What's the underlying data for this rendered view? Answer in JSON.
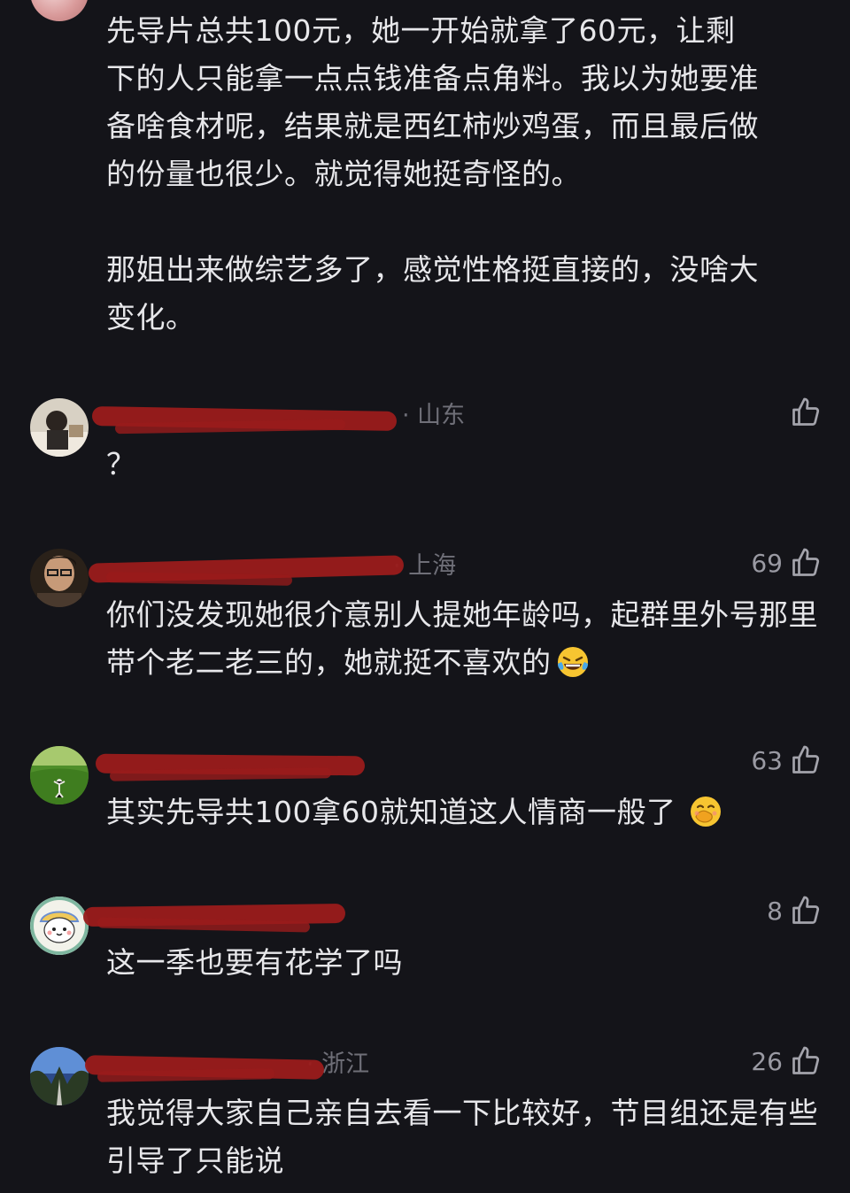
{
  "top_comment": {
    "text": "先导片总共100元，她一开始就拿了60元，让剩\n下的人只能拿一点点钱准备点角料。我以为她要准\n备啥食材呢，结果就是西红柿炒鸡蛋，而且最后做\n的份量也很少。就觉得她挺奇怪的。\n\n那姐出来做综艺多了，感觉性格挺直接的，没啥大\n变化。"
  },
  "comments": [
    {
      "meta_visible": "· 山东",
      "likes": "",
      "text": "？",
      "emoji": ""
    },
    {
      "meta_visible": "· 上海",
      "likes": "69",
      "text": "你们没发现她很介意别人提她年龄吗，起群里外号那里带个老二老三的，她就挺不喜欢的",
      "emoji": "laughing-tears"
    },
    {
      "meta_visible": "",
      "likes": "63",
      "text": "其实先导共100拿60就知道这人情商一般了",
      "emoji": "hand-over-mouth"
    },
    {
      "meta_visible": "",
      "likes": "8",
      "text": "这一季也要有花学了吗",
      "emoji": ""
    },
    {
      "meta_visible": "· 浙江",
      "likes": "26",
      "text": "我觉得大家自己亲自去看一下比较好，节目组还是有些引导了只能说",
      "emoji": ""
    }
  ],
  "colors": {
    "background": "#141419",
    "text": "#e7e7ea",
    "meta": "#6f6f78",
    "redaction": "#9a1b1b"
  },
  "icons": {
    "like": "thumbs-up-icon"
  }
}
